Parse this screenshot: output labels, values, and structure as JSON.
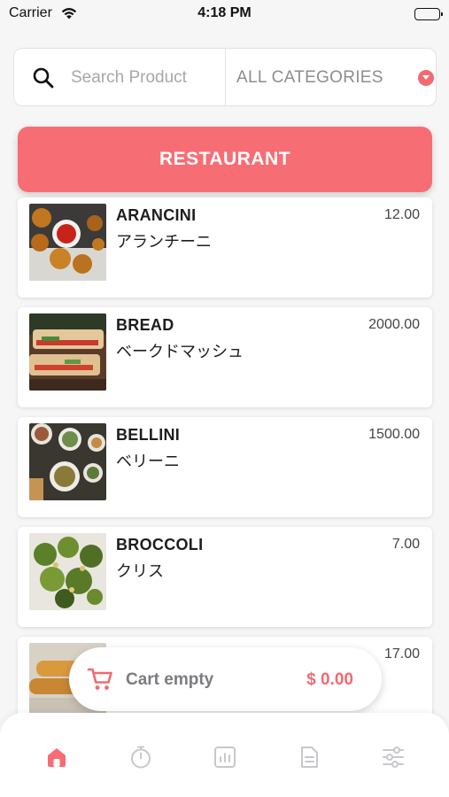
{
  "status_bar": {
    "carrier": "Carrier",
    "time": "4:18 PM"
  },
  "search": {
    "placeholder": "Search Product",
    "value": ""
  },
  "category_filter": {
    "selected": "ALL CATEGORIES"
  },
  "section_button": {
    "label": "RESTAURANT"
  },
  "products": [
    {
      "name": "ARANCINI",
      "subtitle": "アランチーニ",
      "price": "12.00",
      "image": "arancini-image"
    },
    {
      "name": "BREAD",
      "subtitle": "ベークドマッシュ",
      "price": "2000.00",
      "image": "bread-image"
    },
    {
      "name": "BELLINI",
      "subtitle": "ベリーニ",
      "price": "1500.00",
      "image": "bellini-image"
    },
    {
      "name": "BROCCOLI",
      "subtitle": "クリス",
      "price": "7.00",
      "image": "broccoli-image"
    },
    {
      "name": "",
      "subtitle": "",
      "price": "17.00",
      "image": "food-image"
    }
  ],
  "cart": {
    "label": "Cart empty",
    "total": "$ 0.00"
  },
  "tabs": [
    {
      "icon": "home-icon",
      "active": true
    },
    {
      "icon": "timer-icon",
      "active": false
    },
    {
      "icon": "chart-icon",
      "active": false
    },
    {
      "icon": "document-icon",
      "active": false
    },
    {
      "icon": "sliders-icon",
      "active": false
    }
  ],
  "colors": {
    "accent": "#f76d74",
    "background": "#f6f6f7",
    "inactive_icon": "#c8c8cc"
  }
}
